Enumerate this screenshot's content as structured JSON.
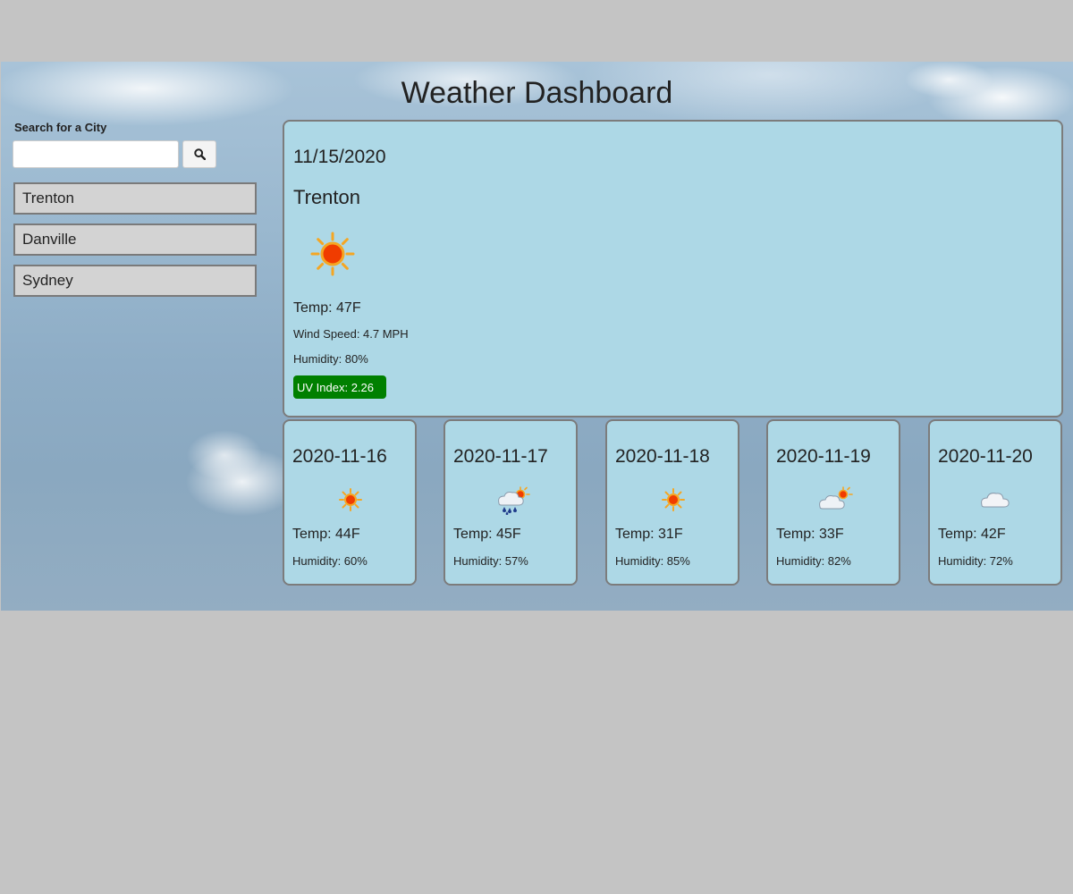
{
  "header": {
    "title": "Weather Dashboard"
  },
  "search": {
    "label": "Search for a City",
    "value": "",
    "placeholder": "",
    "button_icon": "search-icon"
  },
  "history": [
    {
      "label": "Trenton"
    },
    {
      "label": "Danville"
    },
    {
      "label": "Sydney"
    }
  ],
  "current": {
    "date": "11/15/2020",
    "city": "Trenton",
    "icon": "sun-icon",
    "temp": "Temp: 47F",
    "wind": "Wind Speed: 4.7 MPH",
    "humidity": "Humidity: 80%",
    "uv": "UV Index: 2.26",
    "uv_color": "#008000"
  },
  "forecast": [
    {
      "date": "2020-11-16",
      "icon": "sun-icon",
      "temp": "Temp: 44F",
      "humidity": "Humidity: 60%"
    },
    {
      "date": "2020-11-17",
      "icon": "rain-cloud-sun-icon",
      "temp": "Temp: 45F",
      "humidity": "Humidity: 57%"
    },
    {
      "date": "2020-11-18",
      "icon": "sun-icon",
      "temp": "Temp: 31F",
      "humidity": "Humidity: 85%"
    },
    {
      "date": "2020-11-19",
      "icon": "cloud-sun-icon",
      "temp": "Temp: 33F",
      "humidity": "Humidity: 82%"
    },
    {
      "date": "2020-11-20",
      "icon": "cloud-icon",
      "temp": "Temp: 42F",
      "humidity": "Humidity: 72%"
    }
  ],
  "colors": {
    "card_background": "#add8e6",
    "history_background": "#d3d3d3",
    "page_background": "#c4c4c4"
  }
}
